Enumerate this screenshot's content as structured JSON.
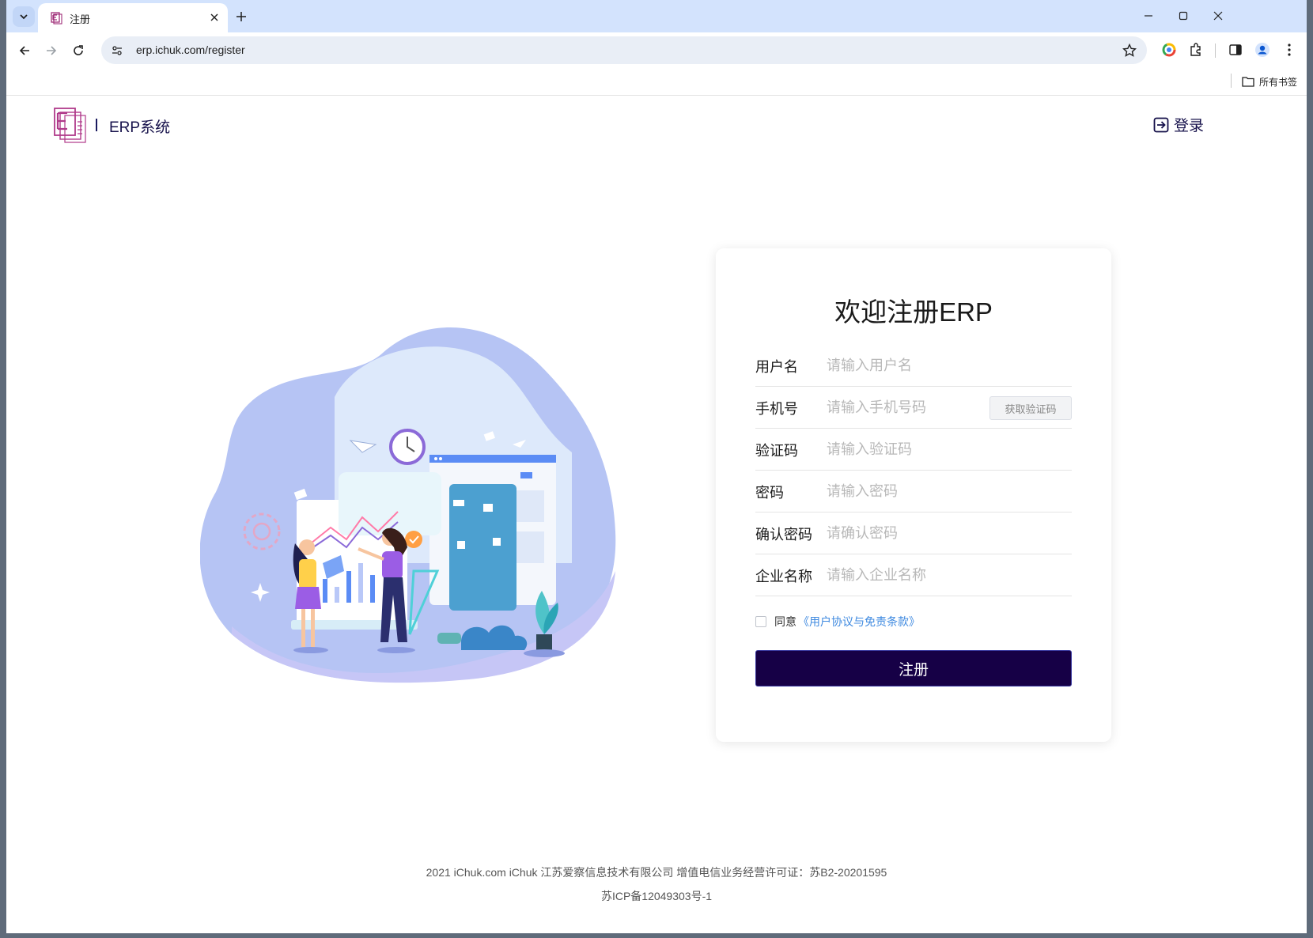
{
  "browser": {
    "tab_title": "注册",
    "url": "erp.ichuk.com/register",
    "bookmarks_all_label": "所有书签",
    "icons": [
      "tab-search-icon",
      "close-icon",
      "plus-icon",
      "minimize-icon",
      "maximize-icon",
      "back-icon",
      "forward-icon",
      "reload-icon",
      "site-info-icon",
      "star-icon",
      "chrome-colors-icon",
      "extensions-icon",
      "side-panel-icon",
      "profile-icon",
      "more-icon",
      "folder-icon"
    ]
  },
  "header": {
    "logo_letter": "E",
    "system_name": "ERP系统",
    "login_label": "登录"
  },
  "form": {
    "title": "欢迎注册ERP",
    "fields": [
      {
        "label": "用户名",
        "placeholder": "请输入用户名"
      },
      {
        "label": "手机号",
        "placeholder": "请输入手机号码"
      },
      {
        "label": "验证码",
        "placeholder": "请输入验证码"
      },
      {
        "label": "密码",
        "placeholder": "请输入密码"
      },
      {
        "label": "确认密码",
        "placeholder": "请确认密码"
      },
      {
        "label": "企业名称",
        "placeholder": "请输入企业名称"
      }
    ],
    "get_code_label": "获取验证码",
    "agree_text": "同意",
    "agree_link": "《用户协议与免责条款》",
    "submit_label": "注册"
  },
  "footer": {
    "line1": "2021 iChuk.com iChuk 江苏爱察信息技术有限公司 增值电信业务经营许可证：苏B2-20201595",
    "line2": "苏ICP备12049303号-1"
  },
  "colors": {
    "brand_dark": "#160046",
    "link": "#3f8ae0",
    "tab_strip": "#d3e3fd"
  }
}
